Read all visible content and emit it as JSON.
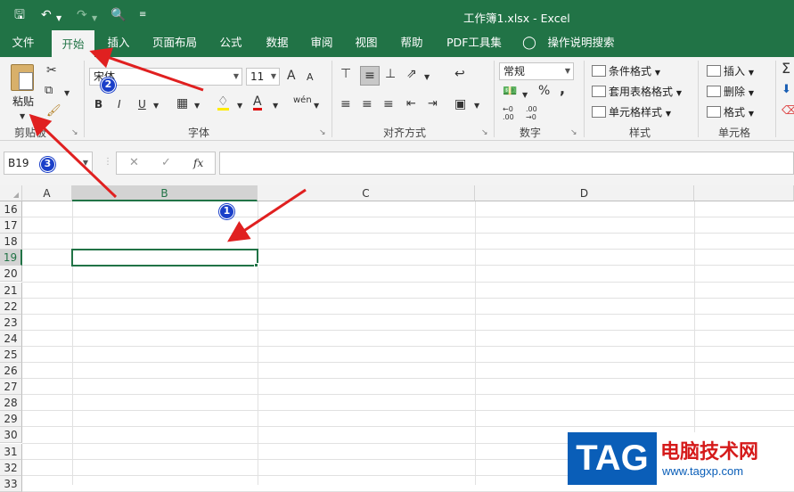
{
  "window": {
    "title": "工作簿1.xlsx  -  Excel"
  },
  "quick_access": {
    "save_icon": "save-icon",
    "undo_icon": "undo-icon",
    "redo_icon": "redo-icon",
    "preview_icon": "print-preview-icon",
    "customize_icon": "customize-quick-access-icon"
  },
  "tabs": [
    "文件",
    "开始",
    "插入",
    "页面布局",
    "公式",
    "数据",
    "审阅",
    "视图",
    "帮助",
    "PDF工具集",
    "操作说明搜索"
  ],
  "active_tab": "开始",
  "ribbon": {
    "clipboard": {
      "paste_label": "粘贴",
      "group_label": "剪贴板"
    },
    "font": {
      "font_name": "宋体",
      "font_size": "11",
      "group_label": "字体",
      "bold": "B",
      "italic": "I",
      "underline": "U",
      "grow": "A",
      "shrink": "A",
      "wen": "wén"
    },
    "alignment": {
      "group_label": "对齐方式"
    },
    "number": {
      "format": "常规",
      "group_label": "数字",
      "percent": "%",
      "comma": ","
    },
    "styles": {
      "conditional": "条件格式",
      "table_format": "套用表格格式",
      "cell_styles": "单元格样式",
      "group_label": "样式"
    },
    "cells": {
      "insert": "插入",
      "delete": "删除",
      "format": "格式",
      "group_label": "单元格"
    }
  },
  "formula_bar": {
    "name_box": "B19",
    "cancel": "✕",
    "enter": "✓",
    "fx": "fx",
    "value": ""
  },
  "sheet": {
    "columns": [
      "A",
      "B",
      "C",
      "D"
    ],
    "selected_column": "B",
    "rows": [
      "16",
      "17",
      "18",
      "19",
      "20",
      "21",
      "22",
      "23",
      "24",
      "25",
      "26",
      "27",
      "28",
      "29",
      "30",
      "31",
      "32",
      "33"
    ],
    "selected_row": "19",
    "active_cell": "B19"
  },
  "annotations": {
    "callout_1": "1",
    "callout_2": "2",
    "callout_3": "3",
    "arrow_color": "#e02020"
  },
  "watermark": {
    "tag": "TAG",
    "site_name": "电脑技术网",
    "url": "www.tagxp.com"
  },
  "colors": {
    "accent": "#217346",
    "callout": "#1a3fc9"
  }
}
